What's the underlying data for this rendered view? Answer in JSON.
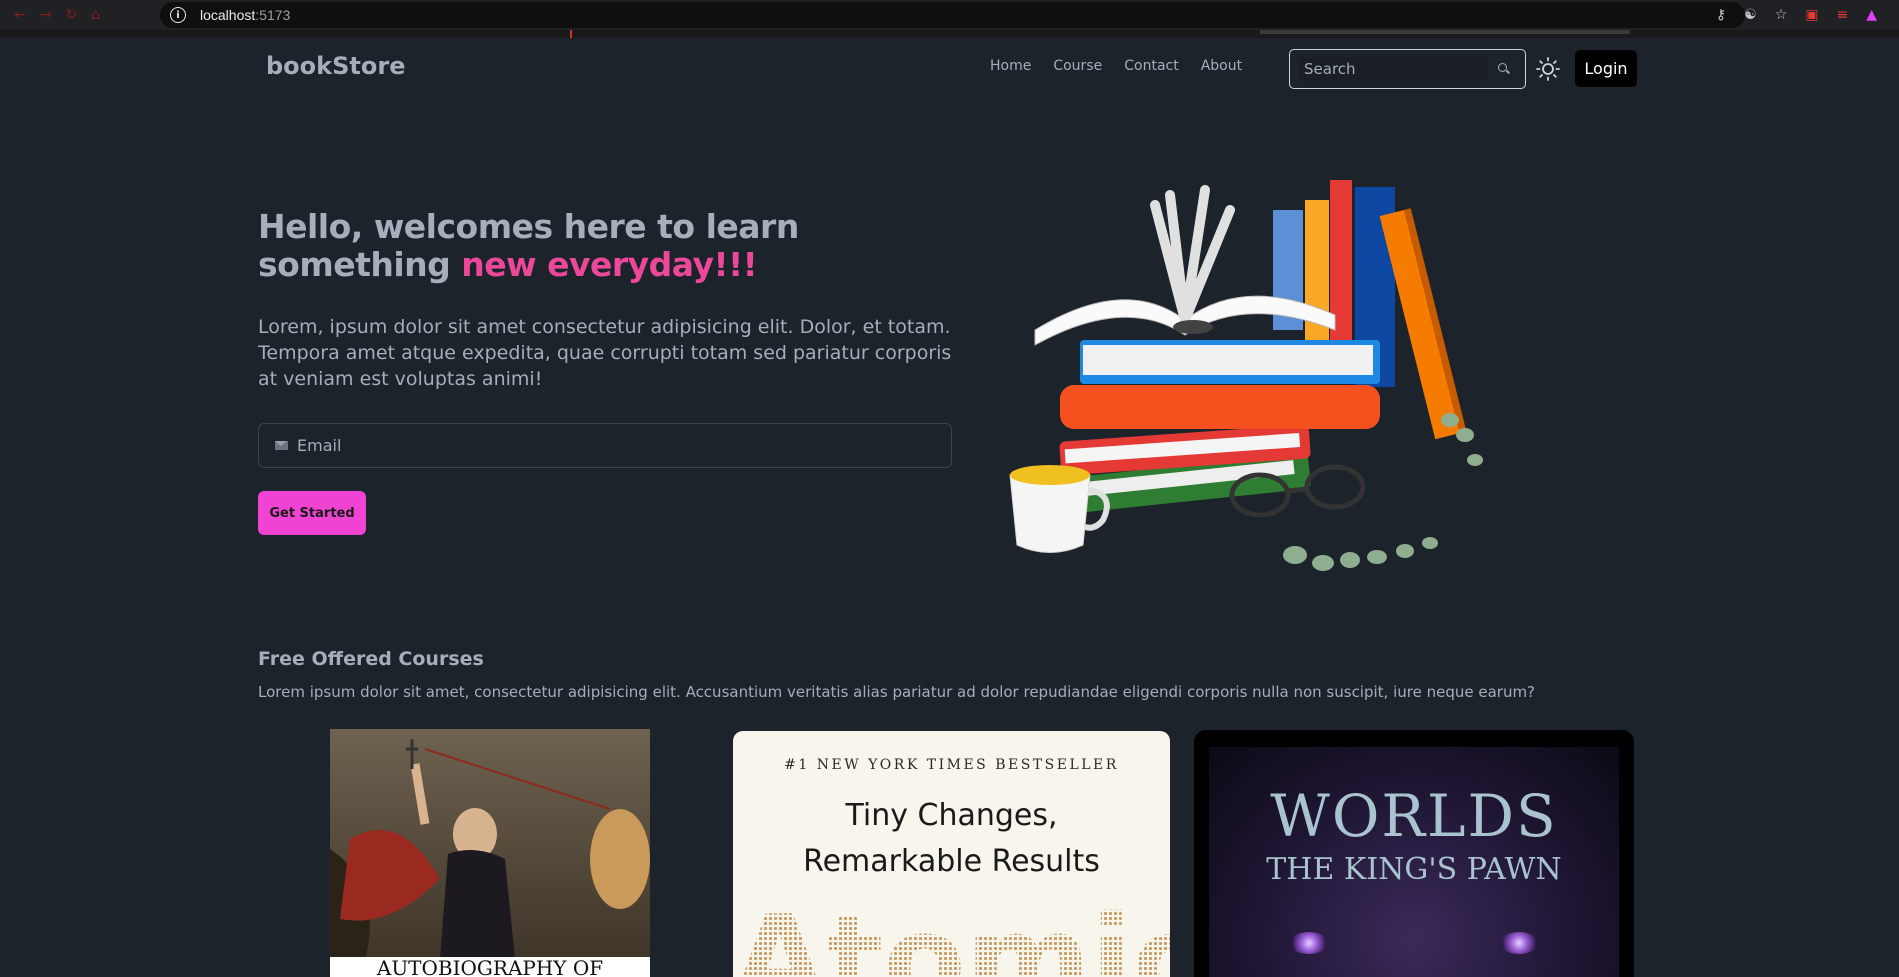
{
  "browser": {
    "host": "localhost",
    "port": ":5173",
    "info_icon": "i",
    "nav_icons": [
      "back-icon",
      "forward-icon",
      "reload-icon",
      "home-icon"
    ],
    "toolbar_icons": [
      "key-icon",
      "translate-icon",
      "star-icon",
      "extension-icon",
      "extension-icon",
      "extension-icon"
    ]
  },
  "navbar": {
    "brand": "bookStore",
    "links": [
      "Home",
      "Course",
      "Contact",
      "About"
    ],
    "search_placeholder": "Search",
    "login_label": "Login"
  },
  "hero": {
    "title_part1": "Hello, welcomes here to learn something ",
    "title_accent": "new everyday!!!",
    "description": "Lorem, ipsum dolor sit amet consectetur adipisicing elit. Dolor, et totam. Tempora amet atque expedita, quae corrupti totam sed pariatur corporis at veniam est voluptas animi!",
    "email_placeholder": "Email",
    "cta_label": "Get Started"
  },
  "courses": {
    "title": "Free Offered Courses",
    "description": "Lorem ipsum dolor sit amet, consectetur adipisicing elit. Accusantium veritatis alias pariatur ad dolor repudiandae eligendi corporis nulla non suscipit, iure neque earum?",
    "cards": [
      {
        "title_visible": "AUTOBIOGRAPHY OF"
      },
      {
        "top": "#1 NEW YORK TIMES BESTSELLER",
        "tagline_line1": "Tiny Changes,",
        "tagline_line2": "Remarkable Results",
        "big": "Atomic"
      },
      {
        "title1": "WORLDS",
        "title2": "THE KING'S PAWN"
      }
    ]
  },
  "colors": {
    "background": "#1d232a",
    "text": "#a6adbb",
    "accent": "#ec4899",
    "cta": "#f143d1"
  }
}
